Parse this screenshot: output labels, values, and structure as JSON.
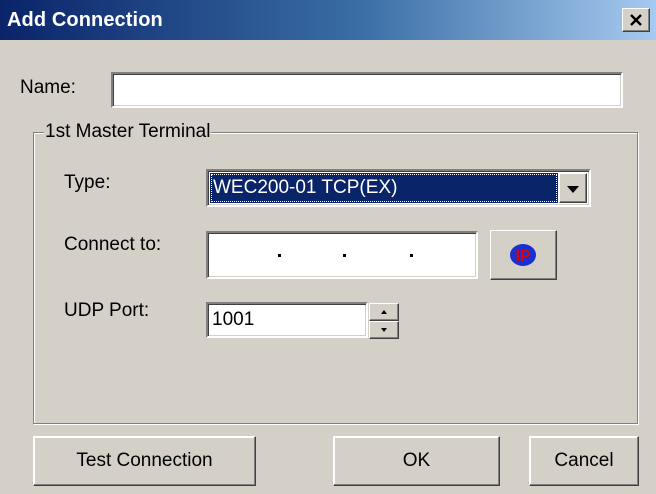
{
  "window": {
    "title": "Add Connection",
    "close_icon": "close-icon"
  },
  "name_field": {
    "label": "Name:",
    "value": ""
  },
  "group": {
    "title": "1st Master Terminal",
    "type_label": "Type:",
    "type_selected": "WEC200-01 TCP(EX)",
    "connect_label": "Connect to:",
    "connect_value": "   .   .   .   ",
    "ip_button_icon": "ip-icon",
    "ip_button_text": "IP",
    "udp_label": "UDP Port:",
    "udp_value": "1001"
  },
  "buttons": {
    "test": "Test Connection",
    "ok": "OK",
    "cancel": "Cancel"
  },
  "colors": {
    "titlebar_start": "#0a246a",
    "titlebar_end": "#a6caf0",
    "selection": "#0a246a",
    "face": "#d4d0c8"
  }
}
